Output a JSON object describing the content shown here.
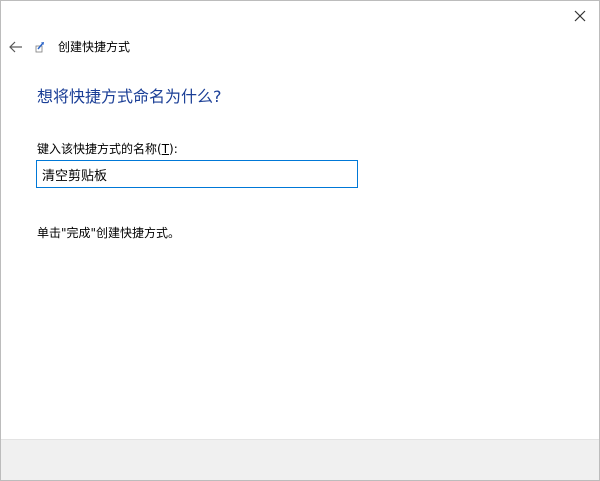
{
  "dialog": {
    "title": "创建快捷方式"
  },
  "page": {
    "heading": "想将快捷方式命名为什么?",
    "label_text": "键入该快捷方式的名称(",
    "label_hotkey": "T",
    "label_suffix": "):",
    "input_value": "清空剪贴板",
    "hint": "单击\"完成\"创建快捷方式。"
  },
  "icons": {
    "close": "close-icon",
    "back": "back-arrow-icon",
    "wizard": "shortcut-wizard-icon"
  },
  "colors": {
    "heading": "#1a3e96",
    "input_border": "#0078d7",
    "footer": "#f0f0f0"
  }
}
